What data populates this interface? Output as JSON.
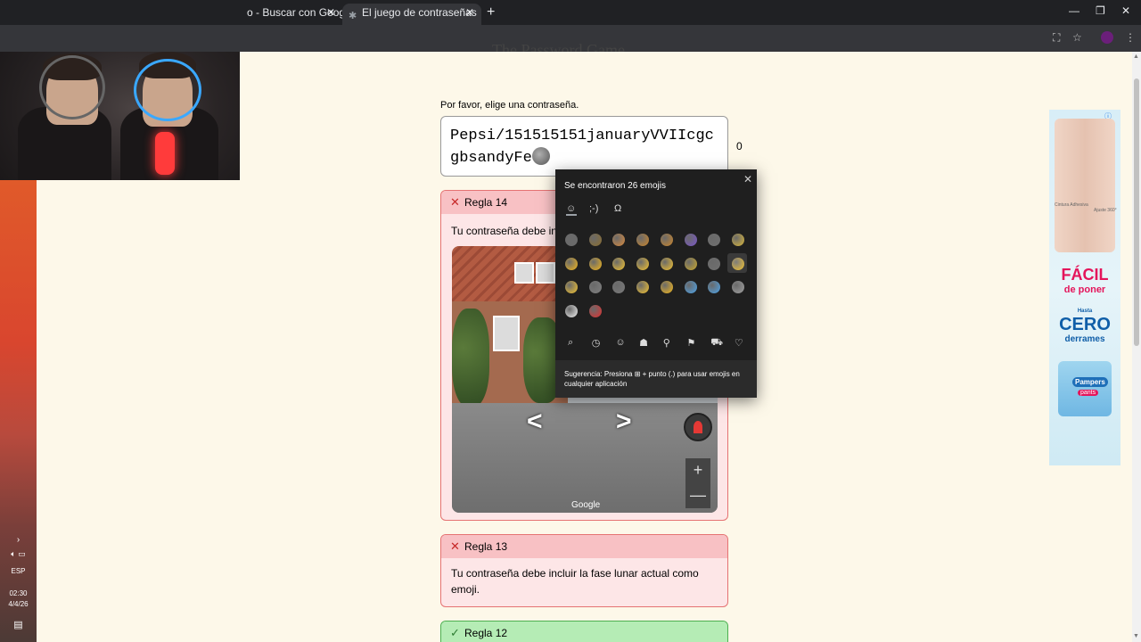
{
  "browser": {
    "tabs": [
      {
        "label": "Buscar con Google",
        "prefix": "o - "
      },
      {
        "label": "El juego de contraseñas"
      }
    ],
    "new_tab": "+",
    "tab_close": "✕",
    "window_controls": {
      "minimize": "—",
      "restore": "❐",
      "close": "✕"
    },
    "toolbar_icons": [
      "translate-icon",
      "star-icon",
      "profile-avatar",
      "menu-icon"
    ]
  },
  "page": {
    "title_fragment": "The Password Game",
    "prompt": "Por favor, elige una contraseña.",
    "password": "Pepsi/151515151januaryVVIIcgcgbsandyFe",
    "password_emoji": "moon-emoji",
    "char_count": "0",
    "rules": [
      {
        "id": "rule-14",
        "title": "Regla 14",
        "status": "failed",
        "body": "Tu contraseña debe incluir el país donde se encuentra esta imagen."
      },
      {
        "id": "rule-13",
        "title": "Regla 13",
        "status": "failed",
        "body": "Tu contraseña debe incluir la fase lunar actual como emoji."
      },
      {
        "id": "rule-12",
        "title": "Regla 12",
        "status": "passed",
        "body": ""
      }
    ],
    "rule14_visible_body": "Tu contraseña debe in",
    "streetview": {
      "brand": "Google",
      "nav_left": "<",
      "nav_right": ">",
      "zoom_in": "+",
      "zoom_out": "—"
    }
  },
  "emoji_panel": {
    "title": "Se encontraron 26 emojis",
    "close": "✕",
    "tabs": [
      {
        "name": "emoji-tab",
        "glyph": "☺"
      },
      {
        "name": "kaomoji-tab",
        "glyph": ";-)"
      },
      {
        "name": "symbols-tab",
        "glyph": "Ω"
      }
    ],
    "emoji_count": 26,
    "categories": [
      "search",
      "recent",
      "smileys",
      "people",
      "places",
      "celebrations",
      "transport",
      "hearts"
    ],
    "category_glyphs": [
      "⌕",
      "◷",
      "☺",
      "☗",
      "⚲",
      "⚑",
      "⛟",
      "♡"
    ],
    "tip": "Sugerencia: Presiona ⊞ + punto (.) para usar emojis en cualquier aplicación"
  },
  "ad": {
    "headline_1": "FÁCIL",
    "headline_2": "de poner",
    "sub_1": "Hasta",
    "sub_2": "CERO",
    "sub_3": "derrames",
    "brand": "Pampers",
    "product": "pants",
    "label_left": "Cintura Adhesiva",
    "label_right": "Ajuste 360°"
  },
  "desktop": {
    "language": "ESP",
    "time": "02:30",
    "date": "4/4/26"
  },
  "colors": {
    "page_bg": "#fdf8e9",
    "rule_fail_bg": "#fde6e7",
    "rule_fail_header": "#f8c1c4",
    "rule_pass_header": "#b5ecb5",
    "panel_bg": "#1f1f1f"
  }
}
